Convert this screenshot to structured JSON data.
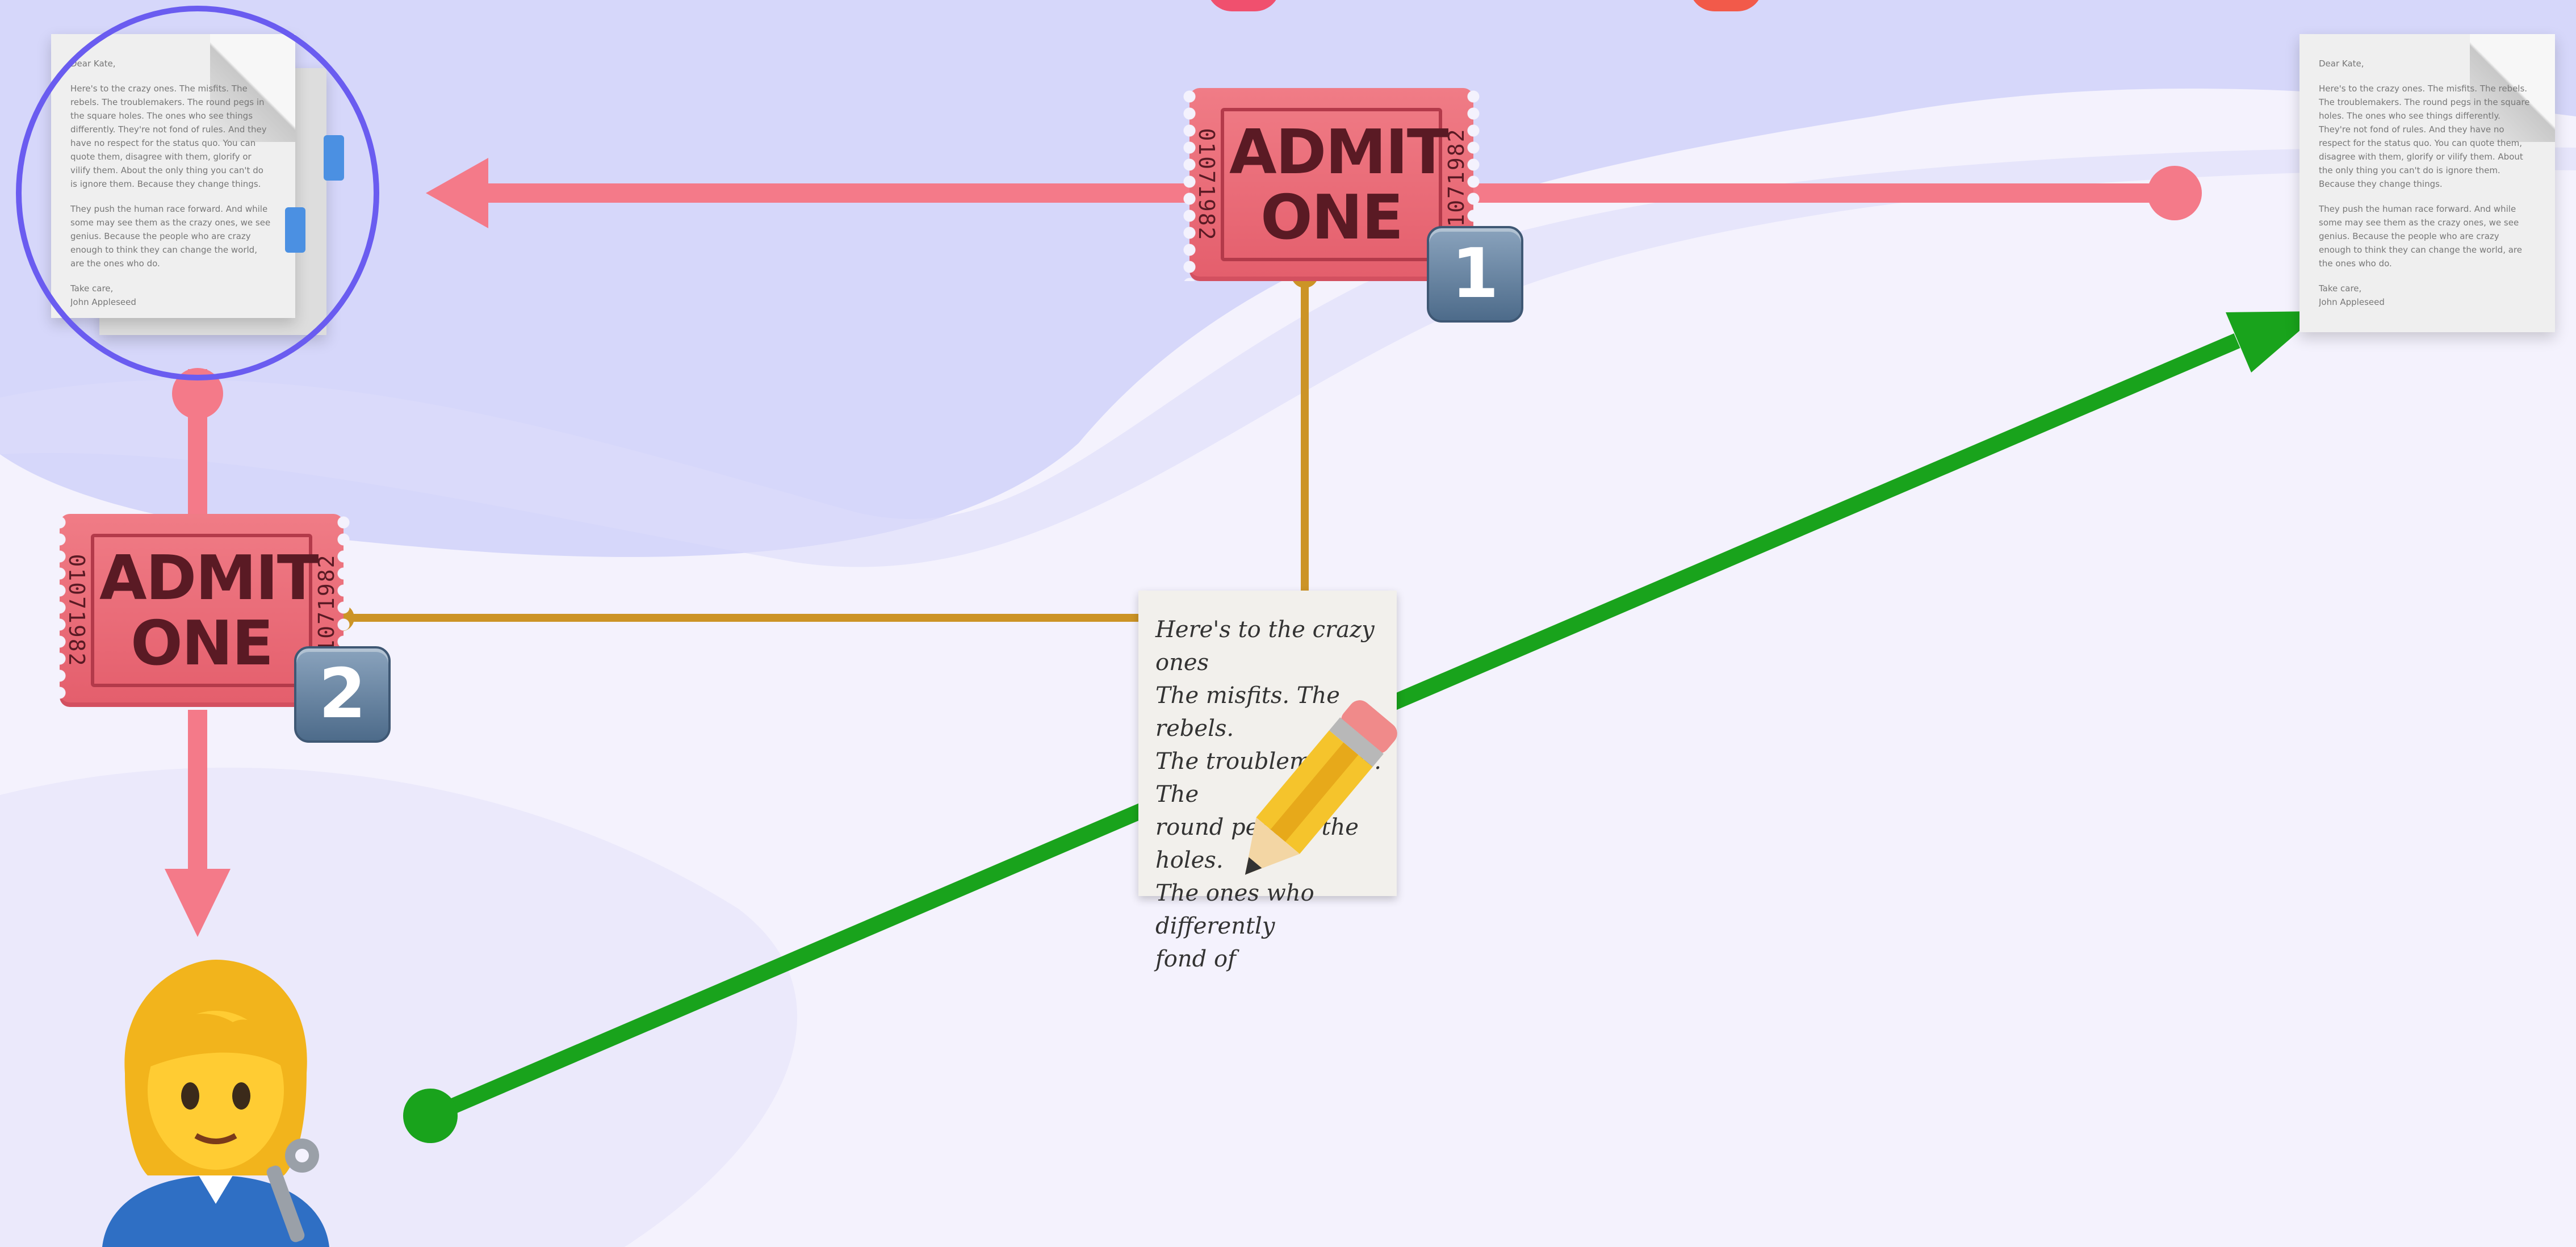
{
  "colors": {
    "bg_lavender": "#d4d6fa",
    "bg_white": "#f6f2fd",
    "arrow_pink": "#f47a89",
    "connector_gold": "#cc9426",
    "arrow_green": "#19a31c",
    "selection_ring": "#6a5cf0",
    "ticket": "#ec6e7c",
    "badge": "#5f7fa0"
  },
  "tickets": [
    {
      "line1": "ADMIT",
      "line2": "ONE",
      "serial": "01071982",
      "badge": "1"
    },
    {
      "line1": "ADMIT",
      "line2": "ONE",
      "serial": "01071982",
      "badge": "2"
    }
  ],
  "document_right": {
    "greeting": "Dear Kate,",
    "para1": "Here's to the crazy ones. The misfits. The rebels. The troublemakers. The round pegs in the square holes. The ones who see things differently. They're not fond of rules. And they have no respect for the status quo. You can quote them, disagree with them, glorify or vilify them. About the only thing you can't do is ignore them. Because they change things.",
    "para2": "They push the human race forward. And while some may see them as the crazy ones, we see genius. Because the people who are crazy enough to think they can change the world, are the ones who do.",
    "closing": "Take care,",
    "signature": "John Appleseed"
  },
  "document_left": {
    "greeting": "Dear Kate,",
    "para1": "Here's to the crazy ones. The misfits. The rebels. The troublemakers. The round pegs in the square holes. The ones who see things differently. They're not fond of rules. And they have no respect for the status quo. You can quote them, disagree with them, glorify or vilify them. About the only thing you can't do is ignore them. Because they change things.",
    "para2": "They push the human race forward. And while some may see them as the crazy ones, we see genius. Because the people who are crazy enough to think they can change the world, are the ones who do.",
    "closing": "Take care,",
    "signature": "John Appleseed"
  },
  "memo": {
    "line1": "Here's to the crazy ones",
    "line2": "The misfits. The rebels.",
    "line3": "The troublemakers. The",
    "line4": "round pegs in the",
    "line5": "holes.",
    "line6": "The ones who",
    "line7": "differently",
    "line8": "fond of"
  },
  "icons": {
    "memo": "memo-icon",
    "person": "woman-mechanic-icon",
    "ticket": "admission-ticket-icon",
    "document": "page-facing-up-icon"
  }
}
